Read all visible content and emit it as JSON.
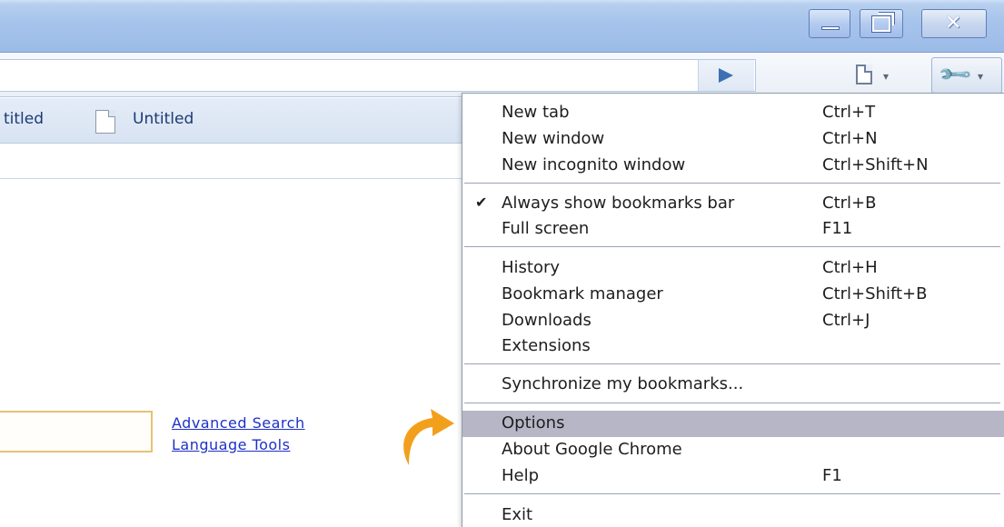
{
  "window": {
    "controls": {
      "minimize": "minimize-icon",
      "maximize": "restore-icon",
      "close": "close-icon"
    }
  },
  "toolbar": {
    "go_icon": "play-arrow-icon",
    "page_menu_icon": "page-icon",
    "wrench_icon": "wrench-icon",
    "dropdown_glyph": "▾"
  },
  "bookmarks": {
    "items": [
      {
        "label": "titled"
      },
      {
        "label": "Untitled"
      }
    ]
  },
  "search": {
    "links": [
      "Advanced Search",
      "Language Tools"
    ]
  },
  "menu": {
    "items": [
      {
        "label": "New tab",
        "shortcut": "Ctrl+T"
      },
      {
        "label": "New window",
        "shortcut": "Ctrl+N"
      },
      {
        "label": "New incognito window",
        "shortcut": "Ctrl+Shift+N"
      },
      {
        "label": "Always show bookmarks bar",
        "shortcut": "Ctrl+B",
        "checked": true
      },
      {
        "label": "Full screen",
        "shortcut": "F11"
      },
      {
        "label": "History",
        "shortcut": "Ctrl+H"
      },
      {
        "label": "Bookmark manager",
        "shortcut": "Ctrl+Shift+B"
      },
      {
        "label": "Downloads",
        "shortcut": "Ctrl+J"
      },
      {
        "label": "Extensions",
        "shortcut": ""
      },
      {
        "label": "Synchronize my bookmarks...",
        "shortcut": ""
      },
      {
        "label": "Options",
        "shortcut": "",
        "highlighted": true
      },
      {
        "label": "About Google Chrome",
        "shortcut": ""
      },
      {
        "label": "Help",
        "shortcut": "F1"
      },
      {
        "label": "Exit",
        "shortcut": ""
      }
    ],
    "check_glyph": "✔"
  },
  "colors": {
    "titlebar": "#9bbbe7",
    "highlight": "#b6b6c6",
    "arrow": "#f2a01c",
    "link": "#1d31c9"
  }
}
